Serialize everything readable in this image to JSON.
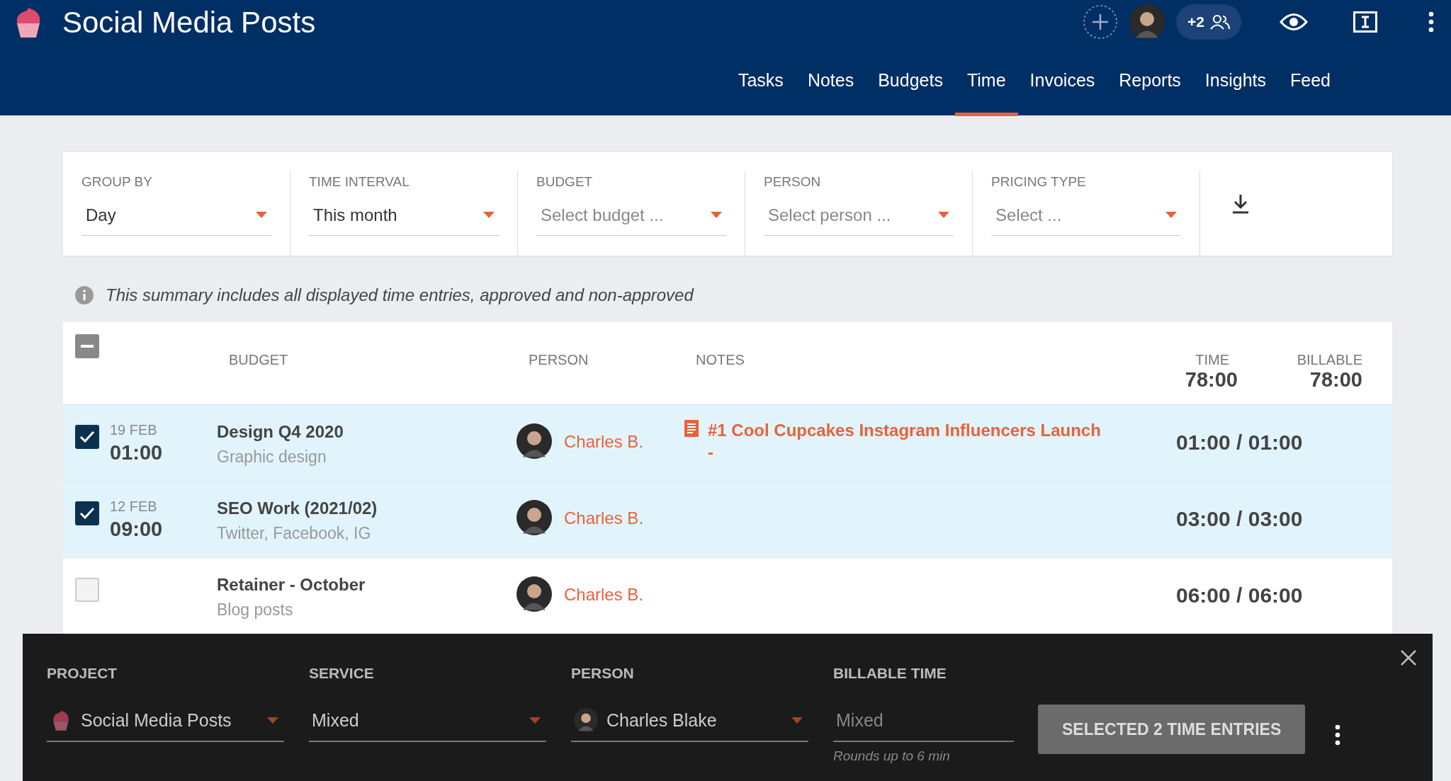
{
  "header": {
    "title": "Social Media Posts",
    "more_people": "+2",
    "tabs": [
      {
        "label": "Tasks",
        "selected": false
      },
      {
        "label": "Notes",
        "selected": false
      },
      {
        "label": "Budgets",
        "selected": false
      },
      {
        "label": "Time",
        "selected": true
      },
      {
        "label": "Invoices",
        "selected": false
      },
      {
        "label": "Reports",
        "selected": false
      },
      {
        "label": "Insights",
        "selected": false
      },
      {
        "label": "Feed",
        "selected": false
      }
    ]
  },
  "filters": [
    {
      "label": "GROUP BY",
      "value": "Day"
    },
    {
      "label": "TIME INTERVAL",
      "value": "This month"
    },
    {
      "label": "BUDGET",
      "placeholder": "Select budget ..."
    },
    {
      "label": "PERSON",
      "placeholder": "Select person ..."
    },
    {
      "label": "PRICING TYPE",
      "placeholder": "Select ..."
    }
  ],
  "summary_note": "This summary includes all displayed time entries, approved and non-approved",
  "table": {
    "select_all_mixed": true,
    "columns": [
      "BUDGET",
      "PERSON",
      "NOTES",
      "TIME",
      "BILLABLE"
    ],
    "total_time": "78:00",
    "total_billable": "78:00",
    "rows": [
      {
        "checked": true,
        "date": "19 FEB",
        "time": "01:00",
        "budget": "Design Q4 2020",
        "service": "Graphic design",
        "person": "Charles B.",
        "note": "#1 Cool Cupcakes Instagram Influencers Launch",
        "note_extra": "-",
        "hours": "01:00 / 01:00"
      },
      {
        "checked": true,
        "date": "12 FEB",
        "time": "09:00",
        "budget": "SEO Work (2021/02)",
        "service": "Twitter, Facebook, IG",
        "person": "Charles B.",
        "hours": "03:00 / 03:00"
      },
      {
        "checked": false,
        "budget": "Retainer - October",
        "service": "Blog posts",
        "person": "Charles B.",
        "hours": "06:00 / 06:00"
      }
    ]
  },
  "bulk_panel": {
    "fields": [
      {
        "kind": "select",
        "label": "PROJECT",
        "value": "Social Media Posts"
      },
      {
        "kind": "select",
        "label": "SERVICE",
        "value": "Mixed"
      },
      {
        "kind": "select",
        "label": "PERSON",
        "value": "Charles Blake"
      },
      {
        "kind": "text",
        "label": "BILLABLE TIME",
        "placeholder": "Mixed",
        "hint": "Rounds up to 6 min"
      }
    ],
    "button": "SELECTED 2 TIME ENTRIES"
  }
}
